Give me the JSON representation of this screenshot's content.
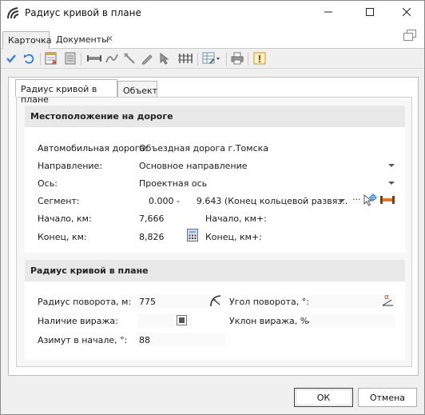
{
  "window": {
    "title": "Радиус кривой в плане",
    "minimize_icon": "minimize-icon",
    "maximize_icon": "maximize-icon",
    "close_icon": "close-icon"
  },
  "doc_tabs": {
    "card": "Карточка",
    "documents": "Документы",
    "close_glyph": "✕"
  },
  "toolbar": {
    "icons": [
      "check-icon",
      "undo-icon",
      "report-icon",
      "document-icon",
      "ruler-icon",
      "curve-icon",
      "measure-icon",
      "pencil-icon",
      "cursor-icon",
      "fence-icon",
      "table-icon",
      "print-icon",
      "warning-icon"
    ]
  },
  "inner_tabs": {
    "radius": "Радиус кривой в плане",
    "object": "Объект"
  },
  "location": {
    "header": "Местоположение на дороге",
    "road_label": "Автомобильная дорога:",
    "road_value": "Объездная дорога г.Томска",
    "direction_label": "Направление:",
    "direction_value": "Основное направление",
    "axis_label": "Ось:",
    "axis_value": "Проектная ось",
    "segment_label": "Сегмент:",
    "segment_value": "0.000 -      9.643 (Конец кольцевой развяз...",
    "segment_more": "···",
    "start_label": "Начало, км:",
    "start_value": "7,666",
    "start_plus_label": "Начало, км+:",
    "end_label": "Конец, км:",
    "end_value": "8,826",
    "end_plus_label": "Конец, км+:"
  },
  "curve": {
    "header": "Радиус кривой в плане",
    "radius_label": "Радиус поворота, м:",
    "radius_value": "775",
    "angle_label": "Угол поворота, °:",
    "angle_value": "",
    "angle_symbol": "α",
    "superelevation_label": "Наличие виража:",
    "superelevation_slope_label": "Уклон виража, ‰:",
    "superelevation_slope_value": "",
    "azimuth_label": "Азимут в начале, °:",
    "azimuth_value": "88"
  },
  "footer": {
    "ok": "ОК",
    "cancel": "Отмена"
  }
}
